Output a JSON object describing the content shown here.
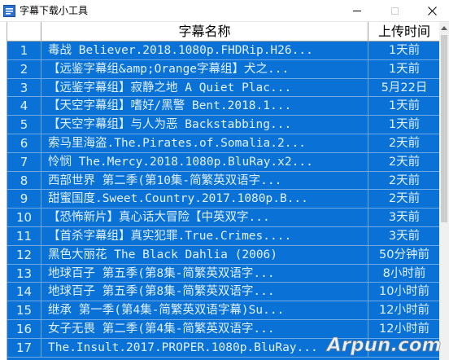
{
  "window": {
    "title": "字幕下载小工具",
    "colors": {
      "grid_bg": "#0a72d6",
      "cell_text": "#dff1ff",
      "header_bg": "#ffffff"
    },
    "icons": {
      "app": "app-icon",
      "minimize": "minimize-icon",
      "maximize": "maximize-icon",
      "close": "close-icon"
    }
  },
  "table": {
    "columns": {
      "index": "",
      "name": "字幕名称",
      "time": "上传时间"
    },
    "rows": [
      {
        "index": "1",
        "name": "毒战 Believer.2018.1080p.FHDRip.H26...",
        "time": "1天前"
      },
      {
        "index": "2",
        "name": "【远鉴字幕组&amp;Orange字幕组】犬之...",
        "time": "1天前"
      },
      {
        "index": "3",
        "name": "【远鉴字幕组】寂静之地 A Quiet Plac...",
        "time": "5月22日"
      },
      {
        "index": "4",
        "name": "【天空字幕组】嗜好/黑警 Bent.2018.1...",
        "time": "1天前"
      },
      {
        "index": "5",
        "name": "【天空字幕组】与人为恶 Backstabbing...",
        "time": "1天前"
      },
      {
        "index": "6",
        "name": "索马里海盗.The.Pirates.of.Somalia.2...",
        "time": "2天前"
      },
      {
        "index": "7",
        "name": "怜悯 The.Mercy.2018.1080p.BluRay.x2...",
        "time": "2天前"
      },
      {
        "index": "8",
        "name": "西部世界 第二季(第10集-简繁英双语字...",
        "time": "2天前"
      },
      {
        "index": "9",
        "name": "甜蜜国度.Sweet.Country.2017.1080p.B...",
        "time": "2天前"
      },
      {
        "index": "10",
        "name": "【恐怖新片】真心话大冒险【中英双字...",
        "time": "3天前"
      },
      {
        "index": "11",
        "name": "【首杀字幕组】真实犯罪.True.Crimes....",
        "time": "3天前"
      },
      {
        "index": "12",
        "name": "黑色大丽花 The Black Dahlia (2006)",
        "time": "50分钟前"
      },
      {
        "index": "13",
        "name": "地球百子 第五季(第8集-简繁英双语字...",
        "time": "8小时前"
      },
      {
        "index": "14",
        "name": "地球百子 第五季(第8集-简繁英双语字...",
        "time": "10小时前"
      },
      {
        "index": "15",
        "name": "继承 第一季(第4集-简繁英双语字幕)Su...",
        "time": "12小时前"
      },
      {
        "index": "16",
        "name": "女子无畏 第二季(第4集-简繁英双语字...",
        "time": "12小时前"
      },
      {
        "index": "17",
        "name": "The.Insult.2017.PROPER.1080p.BluRay...",
        "time": ""
      }
    ]
  },
  "watermark": {
    "text": "Arpun.com"
  }
}
